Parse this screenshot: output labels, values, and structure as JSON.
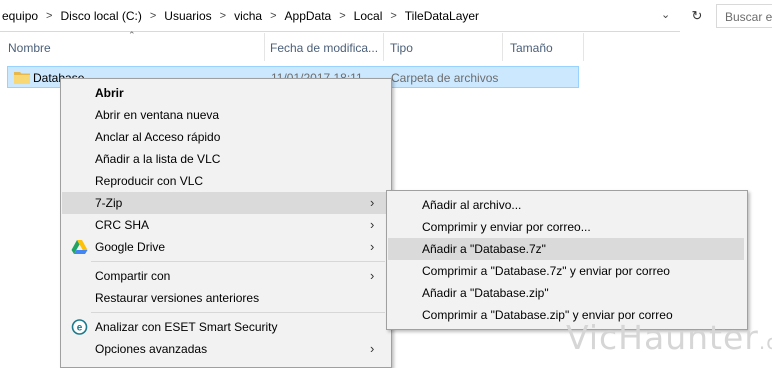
{
  "breadcrumb": {
    "items": [
      "equipo",
      "Disco local (C:)",
      "Usuarios",
      "vicha",
      "AppData",
      "Local",
      "TileDataLayer"
    ],
    "separator": ">",
    "dropdown_icon": "chevron-down-icon"
  },
  "toolbar": {
    "refresh_icon": "refresh-icon"
  },
  "search": {
    "placeholder": "Buscar en"
  },
  "columns": {
    "name": "Nombre",
    "date": "Fecha de modifica...",
    "type": "Tipo",
    "size": "Tamaño"
  },
  "selected_row": {
    "name": "Database",
    "date": "11/01/2017 18:11",
    "type": "Carpeta de archivos"
  },
  "context_menu": {
    "items": [
      {
        "label": "Abrir"
      },
      {
        "label": "Abrir en ventana nueva"
      },
      {
        "label": "Anclar al Acceso rápido"
      },
      {
        "label": "Añadir a la lista de VLC"
      },
      {
        "label": "Reproducir con VLC"
      },
      {
        "label": "7-Zip"
      },
      {
        "label": "CRC SHA"
      },
      {
        "label": "Google Drive"
      },
      {
        "label": "Compartir con"
      },
      {
        "label": "Restaurar versiones anteriores"
      },
      {
        "label": "Analizar con ESET Smart Security"
      },
      {
        "label": "Opciones avanzadas"
      }
    ]
  },
  "submenu_7zip": {
    "items": [
      {
        "label": "Añadir al archivo..."
      },
      {
        "label": "Comprimir y enviar por correo..."
      },
      {
        "label": "Añadir a \"Database.7z\""
      },
      {
        "label": "Comprimir a \"Database.7z\" y enviar por correo"
      },
      {
        "label": "Añadir a \"Database.zip\""
      },
      {
        "label": "Comprimir a \"Database.zip\" y enviar por correo"
      }
    ]
  },
  "colors": {
    "selection_bg": "#cce8ff",
    "selection_border": "#99d1ff",
    "menu_bg": "#f2f2f2",
    "menu_highlight": "#dadada",
    "header_text": "#4c607a"
  },
  "watermark": {
    "text": "VicHaunter",
    "suffix": ".org"
  }
}
